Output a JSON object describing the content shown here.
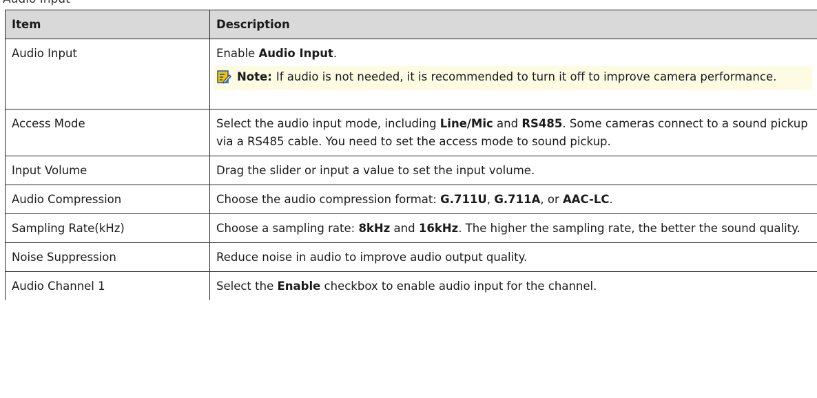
{
  "header_fragment": "Audio Input",
  "table": {
    "headers": {
      "item": "Item",
      "description": "Description"
    },
    "rows": [
      {
        "item": "Audio Input",
        "description": [
          {
            "t": "Enable "
          },
          {
            "t": "Audio Input",
            "b": true
          },
          {
            "t": "."
          }
        ],
        "note": {
          "label": "Note:",
          "text": "If audio is not needed, it is recommended to turn it off to improve camera performance.",
          "icon": "note-pencil-icon",
          "background": "#fefbe3"
        }
      },
      {
        "item": "Access Mode",
        "description": [
          {
            "t": "Select the audio input mode, including "
          },
          {
            "t": "Line/Mic",
            "b": true
          },
          {
            "t": " and "
          },
          {
            "t": "RS485",
            "b": true
          },
          {
            "t": ". Some cameras connect to a sound pickup via a RS485 cable. You need to set the access mode to sound pickup."
          }
        ]
      },
      {
        "item": "Input Volume",
        "description": [
          {
            "t": "Drag the slider or input a value to set the input volume."
          }
        ]
      },
      {
        "item": "Audio Compression",
        "description": [
          {
            "t": "Choose the audio compression format: "
          },
          {
            "t": "G.711U",
            "b": true
          },
          {
            "t": ", "
          },
          {
            "t": "G.711A",
            "b": true
          },
          {
            "t": ", or "
          },
          {
            "t": "AAC-LC",
            "b": true
          },
          {
            "t": "."
          }
        ]
      },
      {
        "item": "Sampling Rate(kHz)",
        "description": [
          {
            "t": "Choose a sampling rate: "
          },
          {
            "t": "8kHz",
            "b": true
          },
          {
            "t": " and "
          },
          {
            "t": "16kHz",
            "b": true
          },
          {
            "t": ". The higher the sampling rate, the better the sound quality."
          }
        ]
      },
      {
        "item": "Noise Suppression",
        "description": [
          {
            "t": "Reduce noise in audio to improve audio output quality."
          }
        ]
      },
      {
        "item": "Audio Channel 1",
        "description": [
          {
            "t": "Select the "
          },
          {
            "t": "Enable",
            "b": true
          },
          {
            "t": " checkbox to enable audio input for the channel."
          }
        ]
      }
    ]
  },
  "colors": {
    "header_background": "#d9d9d9",
    "border": "#222222",
    "note_background": "#fefbe3",
    "note_icon_yellow": "#f4c400",
    "note_icon_blue": "#1f4e8c"
  }
}
